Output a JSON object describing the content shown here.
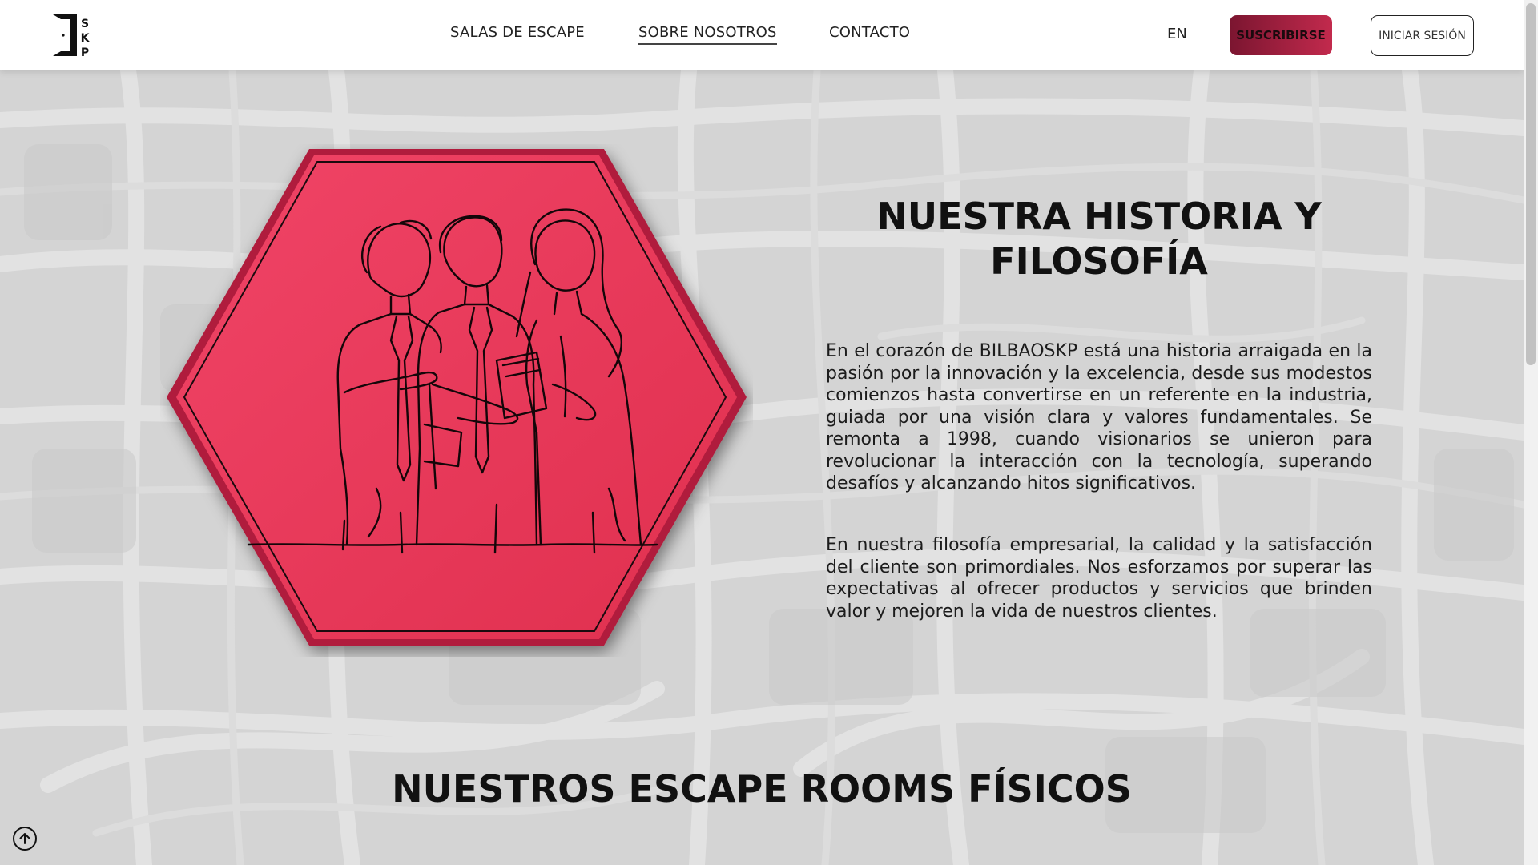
{
  "brand": {
    "logo_text": "SKP"
  },
  "nav": {
    "links": [
      {
        "label": "SALAS DE ESCAPE"
      },
      {
        "label": "SOBRE NOSOTROS",
        "active": true
      },
      {
        "label": "CONTACTO"
      }
    ],
    "language": "EN",
    "subscribe_label": "SUSCRIBIRSE",
    "login_label": "INICIAR SESIÓN"
  },
  "about": {
    "title_line1": "NUESTRA HISTORIA Y",
    "title_line2": "FILOSOFÍA",
    "paragraphs": [
      "En el corazón de BILBAOSKP está una historia arraigada en la pasión por la innovación y la excelencia, desde sus modestos comienzos hasta convertirse en un referente en la industria, guiada por una visión clara y valores fundamentales. Se remonta a 1998, cuando visionarios se unieron para revolucionar la interacción con la tecnología, superando desafíos y alcanzando hitos significativos.",
      "En nuestra filosofía empresarial, la calidad y la satisfacción del cliente son primordiales. Nos esforzamos por superar las expectativas al ofrecer productos y servicios que brinden valor y mejoren la vida de nuestros clientes."
    ],
    "illustration": "team-line-drawing"
  },
  "rooms": {
    "title": "NUESTROS ESCAPE ROOMS FÍSICOS"
  },
  "icons": {
    "scroll_top": "arrow-up-circle-icon"
  },
  "colors": {
    "accent": "#e8375a",
    "subscribe_gradient_start": "#7b1530",
    "subscribe_gradient_end": "#c22a4d",
    "background": "#d4d4d4"
  }
}
